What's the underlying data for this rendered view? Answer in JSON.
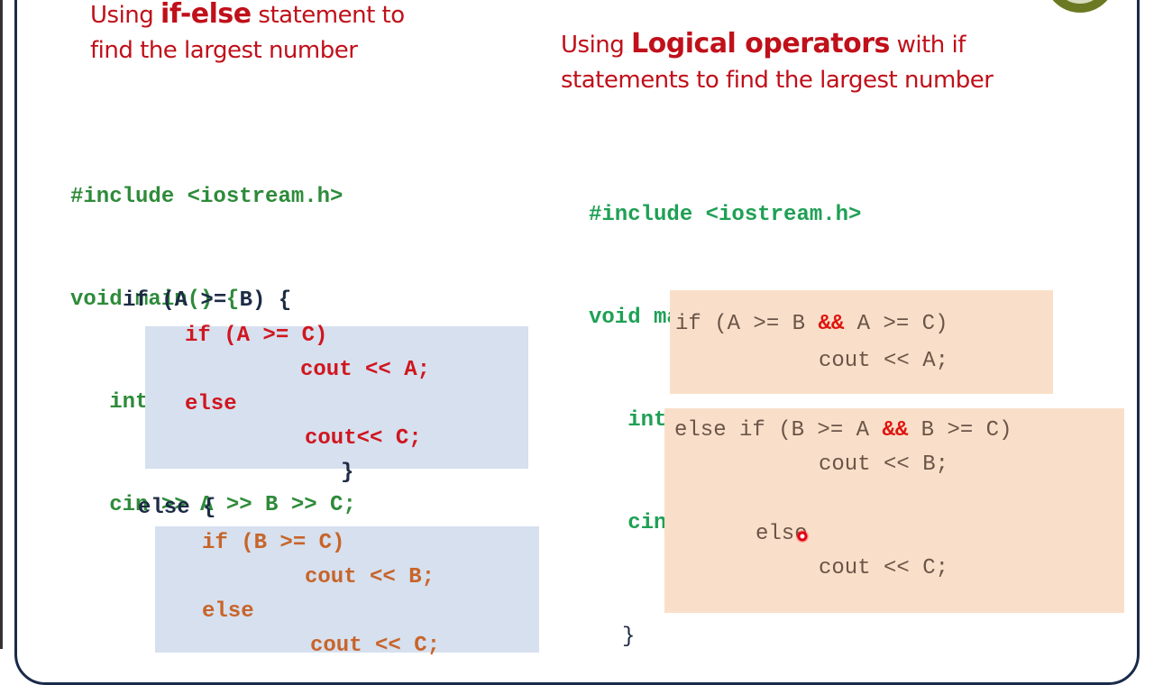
{
  "left_panel": {
    "title_prefix": "Using ",
    "title_keyword": "if-else",
    "title_suffix": " statement to",
    "title_line2": "find the largest number",
    "header_lines": [
      "#include <iostream.h>",
      "void main() {",
      "   int A, B, C;",
      "   cin >> A >> B >> C;"
    ],
    "outer_if": "if (A >= B) {",
    "inner_block_1": [
      "if (A >= C)",
      "cout << A;",
      "else",
      "cout<< C;"
    ],
    "closing_brace": "}",
    "outer_else": "else {",
    "inner_block_2": [
      "if (B >= C)",
      "cout << B;",
      "else",
      "cout << C;"
    ]
  },
  "right_panel": {
    "title_prefix": "Using ",
    "title_keyword": "Logical operators",
    "title_suffix": " with if",
    "title_line2": "statements to find the largest number",
    "header_lines": [
      "#include <iostream.h>",
      "void main(){",
      "   int A, B, C;",
      "   cin >> A >> B >> C;"
    ],
    "block_1": {
      "cond_start": "if (A >= B ",
      "op": "&&",
      "cond_end": " A >= C)",
      "body": "cout << A;"
    },
    "block_2": {
      "cond_start": "else if (B >= A ",
      "op": "&&",
      "cond_end": " B >= C)",
      "body": "cout << B;",
      "else": "else",
      "else_body": "cout << C;"
    },
    "closing_brace": "}"
  },
  "colors": {
    "title": "#c0101a",
    "code_green": "#2e8b3a",
    "operator": "#e0140e",
    "blue_box": "#d6e0ee",
    "peach_box": "#f9dfc9"
  }
}
